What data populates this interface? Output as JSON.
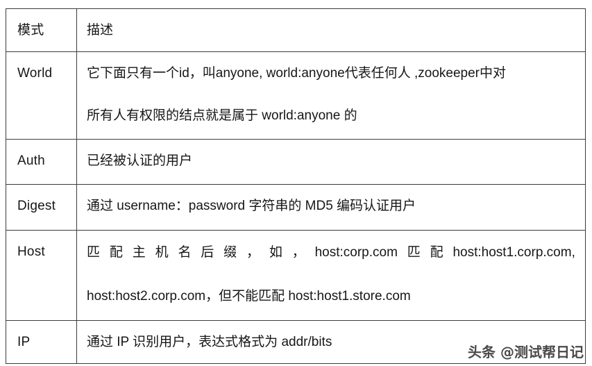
{
  "table": {
    "headers": [
      "模式",
      "描述"
    ],
    "rows": [
      {
        "mode": "World",
        "lines": [
          "它下面只有一个id，叫anyone, world:anyone代表任何人 ,zookeeper中对",
          "所有人有权限的结点就是属于 world:anyone 的"
        ]
      },
      {
        "mode": "Auth",
        "lines": [
          "已经被认证的用户"
        ]
      },
      {
        "mode": "Digest",
        "lines": [
          "通过 username：password 字符串的 MD5 编码认证用户"
        ]
      },
      {
        "mode": "Host",
        "justified_first_line": true,
        "justified_segments": [
          "匹",
          "配",
          "主",
          "机",
          "名",
          "后",
          "缀",
          "，",
          "如",
          "，",
          "host:corp.com",
          "匹",
          "配",
          "host:host1.corp.com,"
        ],
        "lines": [
          "匹配主机名后缀，如，host:corp.com 匹配 host:host1.corp.com,",
          "host:host2.corp.com，但不能匹配 host:host1.store.com"
        ]
      },
      {
        "mode": "IP",
        "lines": [
          "通过 IP 识别用户，表达式格式为 addr/bits"
        ]
      }
    ]
  },
  "watermark": {
    "text": "头条 @测试帮日记"
  },
  "colors": {
    "border": "#3b3b3b",
    "text": "#161616",
    "background": "#ffffff",
    "watermark": "#3a3a3a"
  }
}
